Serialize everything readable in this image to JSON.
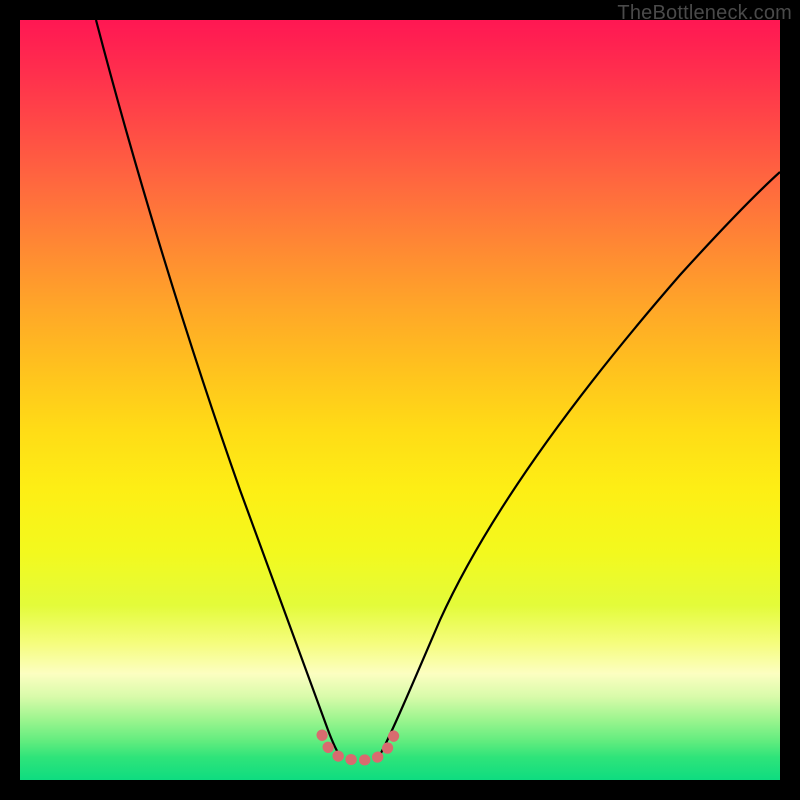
{
  "watermark": "TheBottleneck.com",
  "chart_data": {
    "type": "line",
    "title": "",
    "xlabel": "",
    "ylabel": "",
    "xlim": [
      0,
      100
    ],
    "ylim": [
      0,
      100
    ],
    "grid": false,
    "series": [
      {
        "name": "curve-left",
        "x": [
          10,
          12,
          15,
          18,
          22,
          26,
          30,
          34,
          37,
          39,
          40.5,
          41.5
        ],
        "y": [
          100,
          88,
          75,
          63,
          50,
          38,
          27,
          17,
          10,
          6,
          4,
          3.5
        ]
      },
      {
        "name": "curve-right",
        "x": [
          47.5,
          49,
          51,
          54,
          58,
          63,
          69,
          76,
          84,
          92,
          100
        ],
        "y": [
          3.5,
          5,
          8,
          13,
          20,
          29,
          39,
          50,
          61,
          71,
          80
        ]
      },
      {
        "name": "valley-highlight",
        "x": [
          40,
          41,
          42,
          43,
          44,
          45,
          46,
          47,
          48,
          49
        ],
        "y": [
          5.5,
          4,
          3.2,
          3,
          3,
          3,
          3.2,
          3.8,
          5,
          7
        ]
      }
    ],
    "colors": {
      "curve": "#000000",
      "highlight": "#d86b6f"
    }
  }
}
